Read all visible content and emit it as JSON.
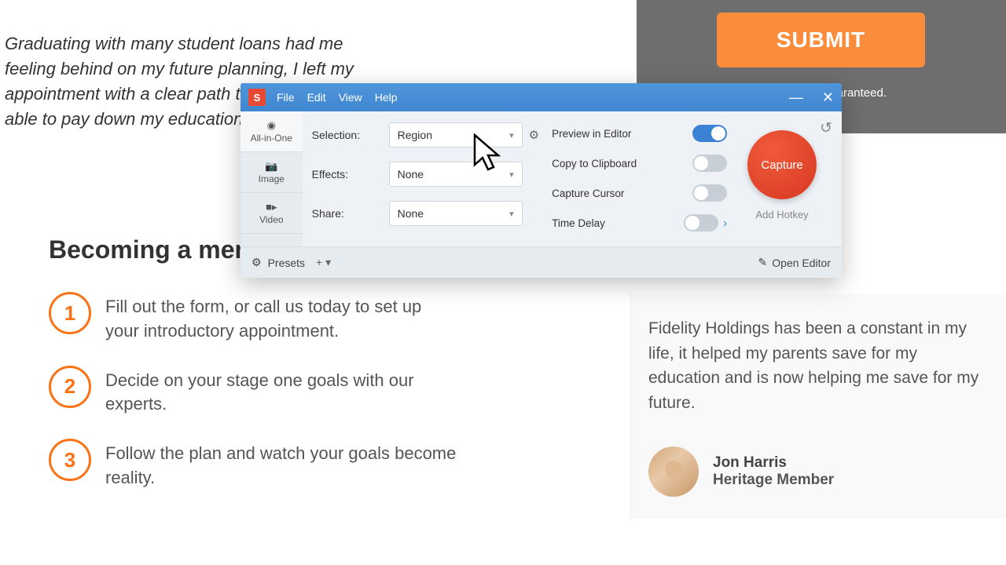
{
  "quote": "Graduating with many student loans had me feeling behind on my future planning, I left my appointment with a clear path to my retirement able to pay down my educational d",
  "submit_label": "SUBMIT",
  "guaranteed": "aranteed.",
  "section_title": "Becoming a mem",
  "steps": [
    {
      "num": "1",
      "text": "Fill out the form, or call us today to set up your introductory appointment."
    },
    {
      "num": "2",
      "text": "Decide on your stage one goals with our experts."
    },
    {
      "num": "3",
      "text": "Follow the plan and watch your goals become reality."
    }
  ],
  "testimonial": {
    "text": "Fidelity Holdings has been a constant in my life, it helped my parents save for my education and is now helping me save for my future.",
    "name": "Jon Harris",
    "role": "Heritage Member"
  },
  "snagit": {
    "menu": {
      "file": "File",
      "edit": "Edit",
      "view": "View",
      "help": "Help"
    },
    "modes": {
      "allinone": "All-in-One",
      "image": "Image",
      "video": "Video"
    },
    "settings": {
      "selection_label": "Selection:",
      "selection_value": "Region",
      "effects_label": "Effects:",
      "effects_value": "None",
      "share_label": "Share:",
      "share_value": "None"
    },
    "toggles": {
      "preview": "Preview in Editor",
      "clipboard": "Copy to Clipboard",
      "cursor": "Capture Cursor",
      "delay": "Time Delay"
    },
    "capture": "Capture",
    "add_hotkey": "Add Hotkey",
    "presets": "Presets",
    "open_editor": "Open Editor"
  }
}
